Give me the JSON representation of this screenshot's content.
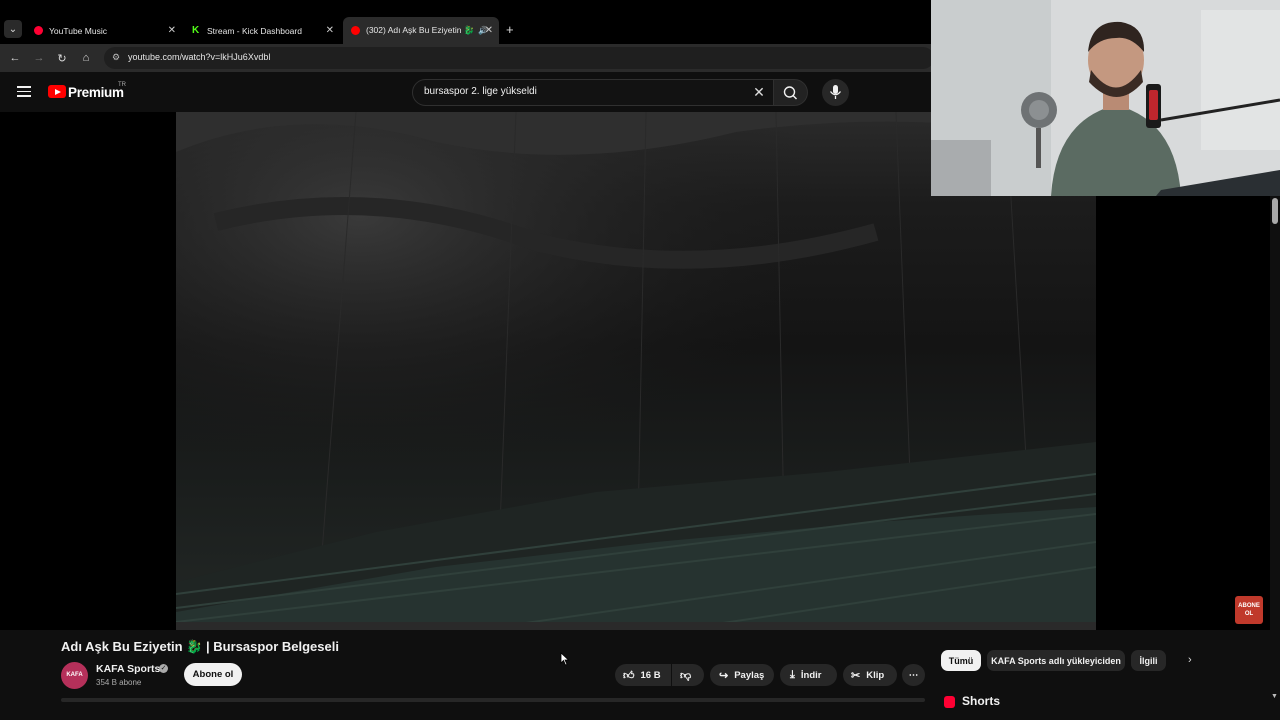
{
  "browser": {
    "tabs": [
      {
        "label": "YouTube Music",
        "favicon": "youtube-music-icon"
      },
      {
        "label": "Stream - Kick Dashboard",
        "favicon": "kick-icon"
      },
      {
        "label": "(302) Adı Aşk Bu Eziyetin 🐉",
        "favicon": "youtube-icon",
        "audio": "🔊"
      }
    ],
    "url": "youtube.com/watch?v=lkHJu6Xvdbl"
  },
  "youtube": {
    "brand": "Premium",
    "country": "TR",
    "search": {
      "value": "bursaspor 2. lige yükseldi"
    }
  },
  "video": {
    "title": "Adı Aşk Bu Eziyetin 🐉 | Bursaspor Belgeseli",
    "watermark": "ABONE OL",
    "channel": {
      "avatar_text": "KAFA",
      "name": "KAFA Sports",
      "subscribers": "354 B abone"
    },
    "subscribe_label": "Abone ol",
    "actions": {
      "likes": "16 B",
      "share": "Paylaş",
      "download": "İndir",
      "clip": "Klip",
      "more": "⋯"
    }
  },
  "sidebar": {
    "chips": [
      "Tümü",
      "KAFA Sports adlı yükleyiciden",
      "İlgili"
    ],
    "shorts_label": "Shorts"
  },
  "colors": {
    "accent": "#ff0000",
    "kick": "#53fc18",
    "background": "#0f0f0f"
  }
}
